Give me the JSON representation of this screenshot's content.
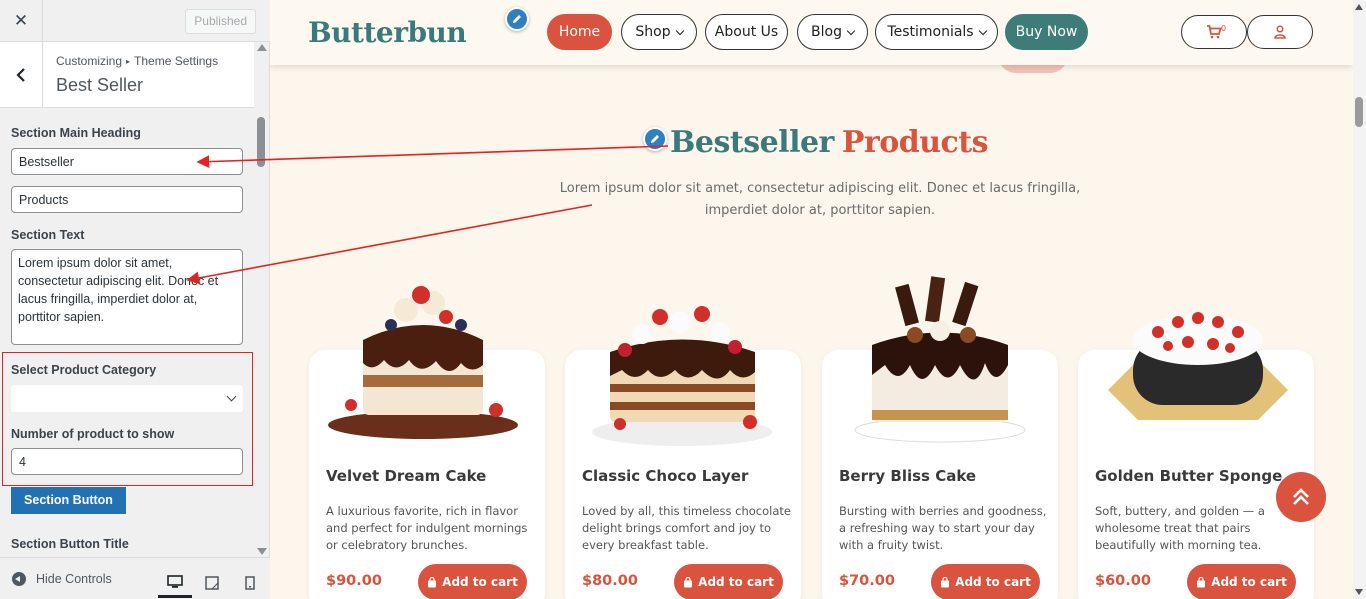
{
  "customizer": {
    "published_label": "Published",
    "breadcrumb_parent": "Customizing",
    "breadcrumb_child": "Theme Settings",
    "section_title": "Best Seller",
    "fields": {
      "main_heading_label": "Section Main Heading",
      "main_heading_value_1": "Bestseller",
      "main_heading_value_2": "Products",
      "section_text_label": "Section Text",
      "section_text_value": "Lorem ipsum dolor sit amet, consectetur adipiscing elit. Donec et lacus fringilla, imperdiet dolor at, porttitor sapien.",
      "category_label": "Select Product Category",
      "category_value": "",
      "count_label": "Number of product to show",
      "count_value": "4",
      "section_button_label": "Section Button",
      "section_button_title_label": "Section Button Title"
    },
    "footer": {
      "hide_controls": "Hide Controls"
    },
    "colors": {
      "primary_blue": "#2271b1",
      "highlight_red": "#e02424"
    }
  },
  "site": {
    "logo": "Butterbun",
    "nav": [
      {
        "label": "Home",
        "active": true
      },
      {
        "label": "Shop",
        "dropdown": true
      },
      {
        "label": "About Us"
      },
      {
        "label": "Blog",
        "dropdown": true
      },
      {
        "label": "Testimonials",
        "dropdown": true
      },
      {
        "label": "Buy Now"
      }
    ],
    "cart_count": "0",
    "section": {
      "heading_part1": "Bestseller",
      "heading_part2": "Products",
      "text": "Lorem ipsum dolor sit amet, consectetur adipiscing elit. Donec et lacus fringilla, imperdiet dolor at, porttitor sapien."
    },
    "products": [
      {
        "name": "Velvet Dream Cake",
        "desc": "A luxurious favorite, rich in flavor and perfect for indulgent mornings or celebratory brunches.",
        "price": "$90.00",
        "cta": "Add to cart"
      },
      {
        "name": "Classic Choco Layer",
        "desc": "Loved by all, this timeless chocolate delight brings comfort and joy to every breakfast table.",
        "price": "$80.00",
        "cta": "Add to cart"
      },
      {
        "name": "Berry Bliss Cake",
        "desc": "Bursting with berries and goodness, a refreshing way to start your day with a fruity twist.",
        "price": "$70.00",
        "cta": "Add to cart"
      },
      {
        "name": "Golden Butter Sponge",
        "desc": "Soft, buttery, and golden — a wholesome treat that pairs beautifully with morning tea.",
        "price": "$60.00",
        "cta": "Add to cart"
      }
    ],
    "colors": {
      "brand_teal": "#3b7a7a",
      "brand_red": "#d9533e",
      "background": "#fcf6ec"
    }
  }
}
